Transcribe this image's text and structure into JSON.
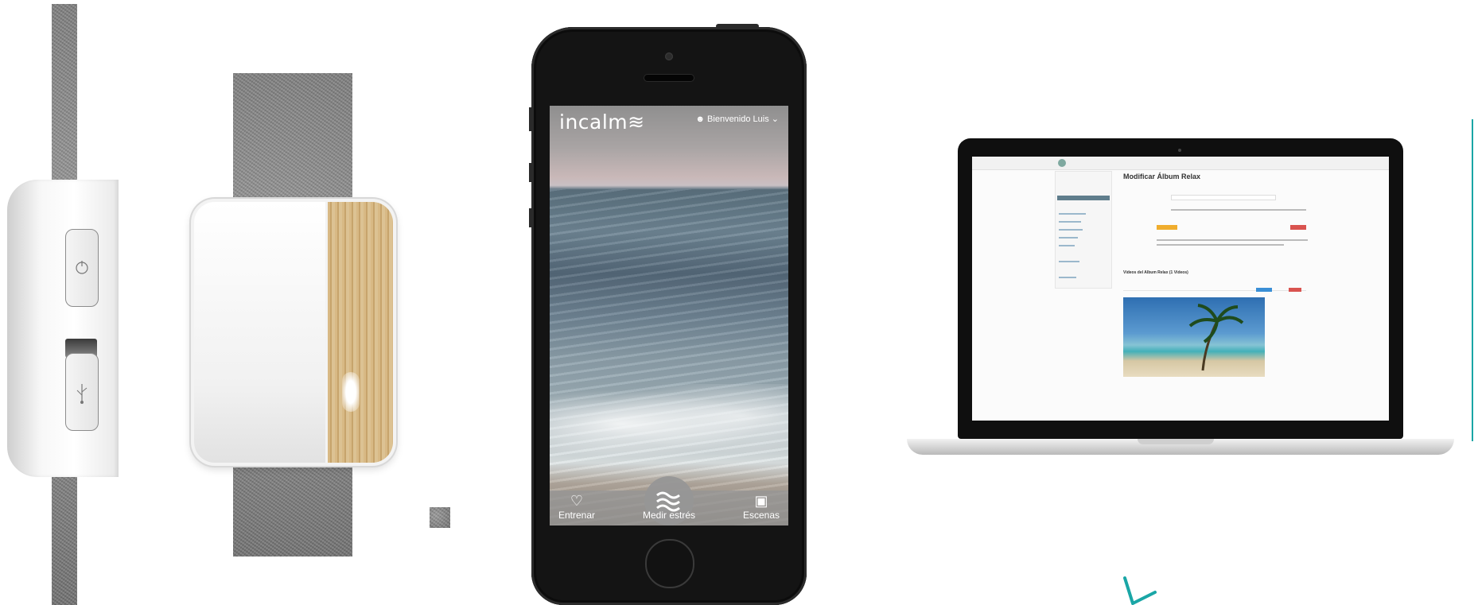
{
  "phone_app": {
    "brand": "incalm≋",
    "welcome": "Bienvenido  Luis",
    "tabs": [
      {
        "label": "Entrenar",
        "icon": "heart-icon"
      },
      {
        "label": "Medir estrés",
        "icon": "waves-icon"
      },
      {
        "label": "Escenas",
        "icon": "image-icon"
      }
    ]
  },
  "laptop_admin": {
    "page_title": "Modificar Álbum Relax",
    "video_section_title": "Vídeos del Album Relax (1 Vídeos)"
  },
  "colors": {
    "felt": "#8a8a8a",
    "wood": "#cfae7a",
    "phone_body": "#141414",
    "admin_sidebar_active": "#5f7d8c",
    "admin_warning_button": "#f0ad2e",
    "admin_danger_button": "#d9534f",
    "admin_primary_button": "#3a8fd6",
    "accent_teal": "#1aa6a6"
  }
}
